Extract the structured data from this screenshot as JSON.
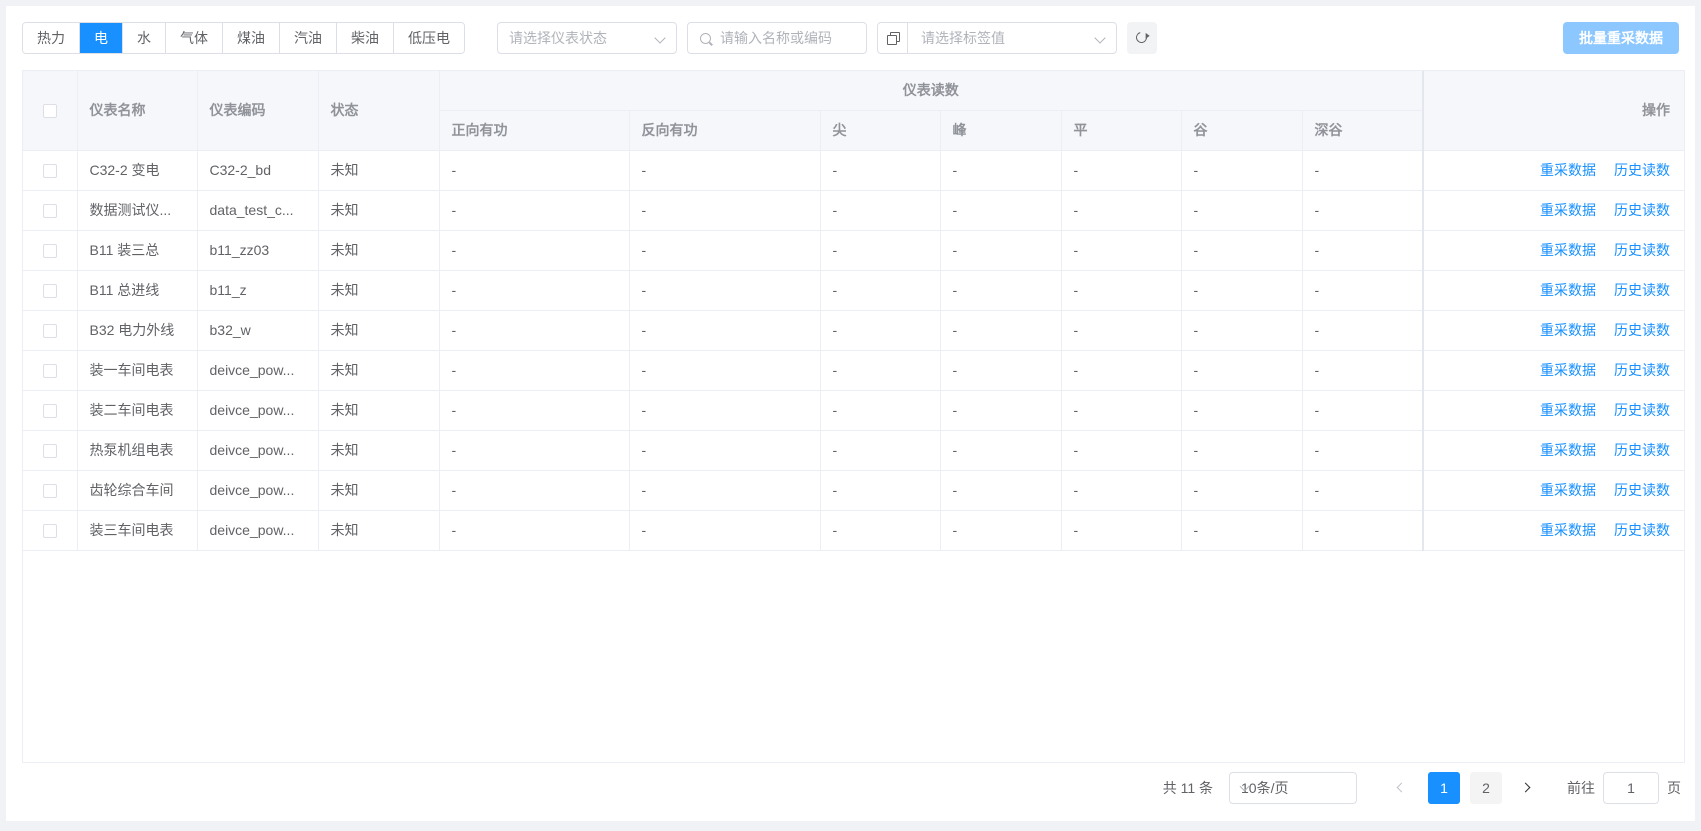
{
  "toolbar": {
    "tabs": [
      {
        "label": "热力",
        "active": false
      },
      {
        "label": "电",
        "active": true
      },
      {
        "label": "水",
        "active": false
      },
      {
        "label": "气体",
        "active": false
      },
      {
        "label": "煤油",
        "active": false
      },
      {
        "label": "汽油",
        "active": false
      },
      {
        "label": "柴油",
        "active": false
      },
      {
        "label": "低压电",
        "active": false
      }
    ],
    "status_placeholder": "请选择仪表状态",
    "search_placeholder": "请输入名称或编码",
    "tag_placeholder": "请选择标签值",
    "batch_label": "批量重采数据",
    "icons": {
      "search": "search-icon",
      "tag_prefix": "copy-icon",
      "refresh": "refresh-icon",
      "dropdown": "chevron-down-icon"
    }
  },
  "table": {
    "headers": {
      "name": "仪表名称",
      "code": "仪表编码",
      "status": "状态",
      "readings_group": "仪表读数",
      "forward": "正向有功",
      "reverse": "反向有功",
      "sharp": "尖",
      "peak": "峰",
      "flat": "平",
      "valley": "谷",
      "deep_valley": "深谷",
      "ops": "操作"
    },
    "op_labels": {
      "recollect": "重采数据",
      "history": "历史读数"
    },
    "rows": [
      {
        "name": "C32-2 变电",
        "code": "C32-2_bd",
        "status": "未知",
        "forward": "-",
        "reverse": "-",
        "sharp": "-",
        "peak": "-",
        "flat": "-",
        "valley": "-",
        "deep_valley": "-"
      },
      {
        "name": "数据测试仪...",
        "code": "data_test_c...",
        "status": "未知",
        "forward": "-",
        "reverse": "-",
        "sharp": "-",
        "peak": "-",
        "flat": "-",
        "valley": "-",
        "deep_valley": "-"
      },
      {
        "name": "B11 装三总",
        "code": "b11_zz03",
        "status": "未知",
        "forward": "-",
        "reverse": "-",
        "sharp": "-",
        "peak": "-",
        "flat": "-",
        "valley": "-",
        "deep_valley": "-"
      },
      {
        "name": "B11 总进线",
        "code": "b11_z",
        "status": "未知",
        "forward": "-",
        "reverse": "-",
        "sharp": "-",
        "peak": "-",
        "flat": "-",
        "valley": "-",
        "deep_valley": "-"
      },
      {
        "name": "B32 电力外线",
        "code": "b32_w",
        "status": "未知",
        "forward": "-",
        "reverse": "-",
        "sharp": "-",
        "peak": "-",
        "flat": "-",
        "valley": "-",
        "deep_valley": "-"
      },
      {
        "name": "装一车间电表",
        "code": "deivce_pow...",
        "status": "未知",
        "forward": "-",
        "reverse": "-",
        "sharp": "-",
        "peak": "-",
        "flat": "-",
        "valley": "-",
        "deep_valley": "-"
      },
      {
        "name": "装二车间电表",
        "code": "deivce_pow...",
        "status": "未知",
        "forward": "-",
        "reverse": "-",
        "sharp": "-",
        "peak": "-",
        "flat": "-",
        "valley": "-",
        "deep_valley": "-"
      },
      {
        "name": "热泵机组电表",
        "code": "deivce_pow...",
        "status": "未知",
        "forward": "-",
        "reverse": "-",
        "sharp": "-",
        "peak": "-",
        "flat": "-",
        "valley": "-",
        "deep_valley": "-"
      },
      {
        "name": "齿轮综合车间",
        "code": "deivce_pow...",
        "status": "未知",
        "forward": "-",
        "reverse": "-",
        "sharp": "-",
        "peak": "-",
        "flat": "-",
        "valley": "-",
        "deep_valley": "-"
      },
      {
        "name": "装三车间电表",
        "code": "deivce_pow...",
        "status": "未知",
        "forward": "-",
        "reverse": "-",
        "sharp": "-",
        "peak": "-",
        "flat": "-",
        "valley": "-",
        "deep_valley": "-"
      }
    ]
  },
  "pagination": {
    "total_text": "共 11 条",
    "page_size": "10条/页",
    "pages": [
      "1",
      "2"
    ],
    "current_page": "1",
    "goto_label": "前往",
    "goto_value": "1",
    "page_suffix": "页"
  },
  "colors": {
    "primary": "#1890ff",
    "primary_disabled": "#8cc8ff",
    "header_bg": "#f5f7fa",
    "border": "#ebeef5"
  }
}
